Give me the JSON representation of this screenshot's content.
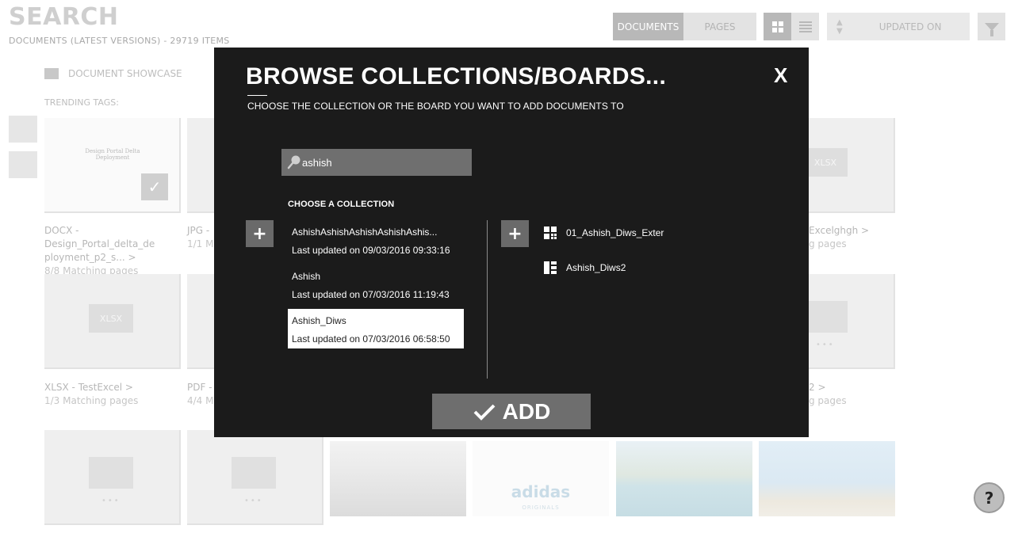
{
  "background": {
    "page_title": "SEARCH",
    "page_subtitle": "DOCUMENTS (LATEST VERSIONS) - 29719 ITEMS",
    "segment": {
      "documents": "DOCUMENTS",
      "pages": "PAGES"
    },
    "sort_label": "UPDATED ON",
    "tab_showcase": "DOCUMENT SHOWCASE",
    "trending_tags": "TRENDING TAGS:",
    "tile_mini_title": "Design Portal Delta Deployment",
    "xlsx_label": "XLSX",
    "captions": [
      {
        "title": "DOCX - Design_Portal_delta_de ployment_p2_s... >",
        "sub": "8/8 Matching pages"
      },
      {
        "title": "JPG - ",
        "sub": "1/1 Ma"
      },
      {
        "title": "Excelghgh >",
        "sub": "g pages"
      },
      {
        "title": "XLSX - TestExcel >",
        "sub": "1/3 Matching pages"
      },
      {
        "title": "PDF - ",
        "sub": "4/4 Ma"
      },
      {
        "title": "2 >",
        "sub": "g pages"
      }
    ],
    "adidas_text": "adidas",
    "adidas_sub": "ORIGINALS",
    "help_label": "?"
  },
  "modal": {
    "title": "BROWSE COLLECTIONS/BOARDS...",
    "subtitle": "CHOOSE THE COLLECTION OR THE BOARD YOU WANT TO ADD DOCUMENTS TO",
    "close_label": "X",
    "search_value": "ashish",
    "choose_label": "CHOOSE A COLLECTION",
    "collections": [
      {
        "name": "AshishAshishAshishAshishAshis...",
        "updated": "Last updated on 09/03/2016 09:33:16",
        "selected": false
      },
      {
        "name": "Ashish",
        "updated": "Last updated on 07/03/2016 11:19:43",
        "selected": false
      },
      {
        "name": "Ashish_Diws",
        "updated": "Last updated on 07/03/2016 06:58:50",
        "selected": true
      }
    ],
    "boards": [
      {
        "name": "01_Ashish_Diws_Exter",
        "icon": "board-grid-icon"
      },
      {
        "name": "Ashish_Diws2",
        "icon": "board-layout-icon"
      }
    ],
    "add_label": "ADD"
  },
  "colors": {
    "modal_bg": "#1b1b1b",
    "button_gray": "#6e6e6e",
    "selected_bg": "#ffffff"
  }
}
